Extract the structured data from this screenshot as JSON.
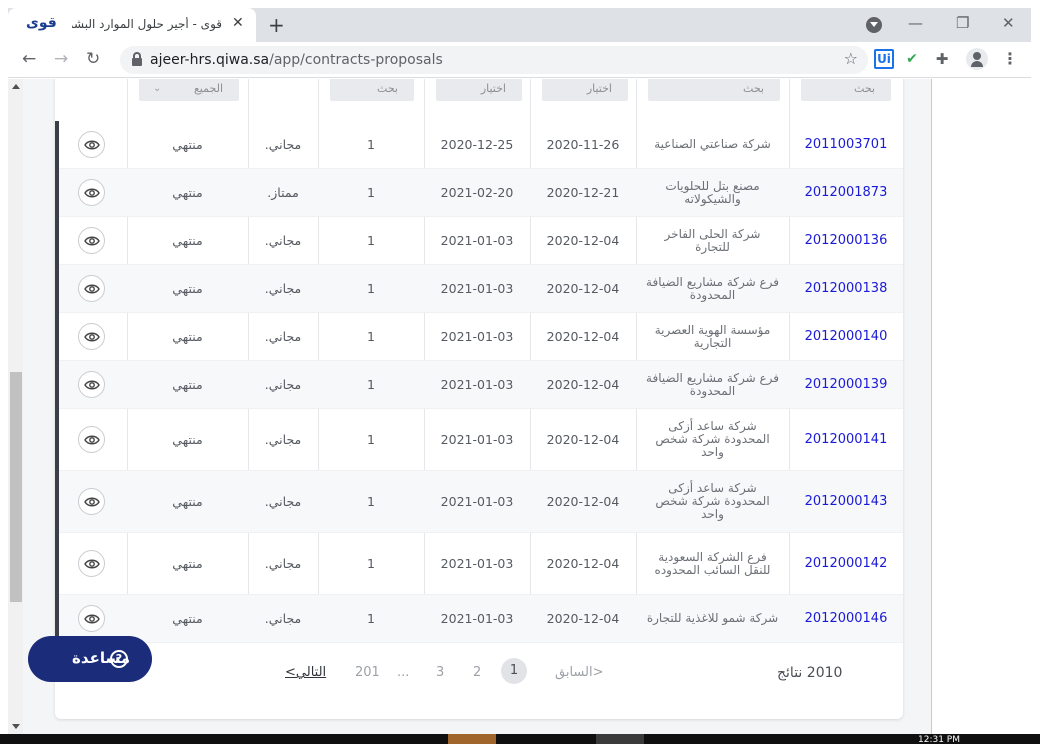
{
  "browser": {
    "tab_title": "قوى - أجير حلول الموارد البشرية",
    "favicon_text": "قوى",
    "close_glyph": "✕",
    "new_tab_glyph": "+",
    "minimize_glyph": "—",
    "restore_glyph": "❐",
    "window_close_glyph": "✕",
    "url_host": "ajeer-hrs.qiwa.sa",
    "url_path": "/app/contracts-proposals",
    "back_glyph": "←",
    "forward_glyph": "→",
    "reload_glyph": "↻",
    "star_glyph": "☆",
    "ext_ui_text": "Ui",
    "ext_check_glyph": "✔",
    "puzzle_glyph": "✚",
    "menu_glyph": "⋮"
  },
  "table": {
    "filters": {
      "col1": "بحث",
      "col2": "بحث",
      "col3": "اختيار",
      "col4": "اختيار",
      "col5": "بحث",
      "col8": "الجميع",
      "chevron": "⌄"
    },
    "rows": [
      {
        "id": "2011003701",
        "name": "شركة صناعتي الصناعية",
        "start": "2020-11-26",
        "end": "2020-12-25",
        "count": "1",
        "type": "مجاني.",
        "status": "منتهي"
      },
      {
        "id": "2012001873",
        "name": "مصنع بتل للحلويات والشيكولاته",
        "start": "2020-12-21",
        "end": "2021-02-20",
        "count": "1",
        "type": "ممتاز.",
        "status": "منتهي"
      },
      {
        "id": "2012000136",
        "name": "شركة الحلى الفاخر للتجارة",
        "start": "2020-12-04",
        "end": "2021-01-03",
        "count": "1",
        "type": "مجاني.",
        "status": "منتهي"
      },
      {
        "id": "2012000138",
        "name": "فرع شركة مشاريع الضيافة المحدودة",
        "start": "2020-12-04",
        "end": "2021-01-03",
        "count": "1",
        "type": "مجاني.",
        "status": "منتهي"
      },
      {
        "id": "2012000140",
        "name": "مؤسسة الهوية العصرية التجارية",
        "start": "2020-12-04",
        "end": "2021-01-03",
        "count": "1",
        "type": "مجاني.",
        "status": "منتهي"
      },
      {
        "id": "2012000139",
        "name": "فرع شركة مشاريع الضيافة المحدودة",
        "start": "2020-12-04",
        "end": "2021-01-03",
        "count": "1",
        "type": "مجاني.",
        "status": "منتهي"
      },
      {
        "id": "2012000141",
        "name": "شركة ساعد أزكى المحدودة شركة شخص واحد",
        "start": "2020-12-04",
        "end": "2021-01-03",
        "count": "1",
        "type": "مجاني.",
        "status": "منتهي"
      },
      {
        "id": "2012000143",
        "name": "شركة ساعد أزكى المحدودة شركة شخص واحد",
        "start": "2020-12-04",
        "end": "2021-01-03",
        "count": "1",
        "type": "مجاني.",
        "status": "منتهي"
      },
      {
        "id": "2012000142",
        "name": "فرع الشركة السعودية للنقل السائب المحدوده",
        "start": "2020-12-04",
        "end": "2021-01-03",
        "count": "1",
        "type": "مجاني.",
        "status": "منتهي"
      },
      {
        "id": "2012000146",
        "name": "شركة شمو للاغذية للتجارة",
        "start": "2020-12-04",
        "end": "2021-01-03",
        "count": "1",
        "type": "مجاني.",
        "status": "منتهي"
      }
    ]
  },
  "pagination": {
    "total": "2010 نتائج",
    "prev": "<السابق",
    "pages": [
      "1",
      "2",
      "3",
      "...",
      "201"
    ],
    "next": "التالي>"
  },
  "help": {
    "label": "مساعدة",
    "icon_glyph": "?"
  },
  "taskbar": {
    "time": "12:31 PM"
  }
}
